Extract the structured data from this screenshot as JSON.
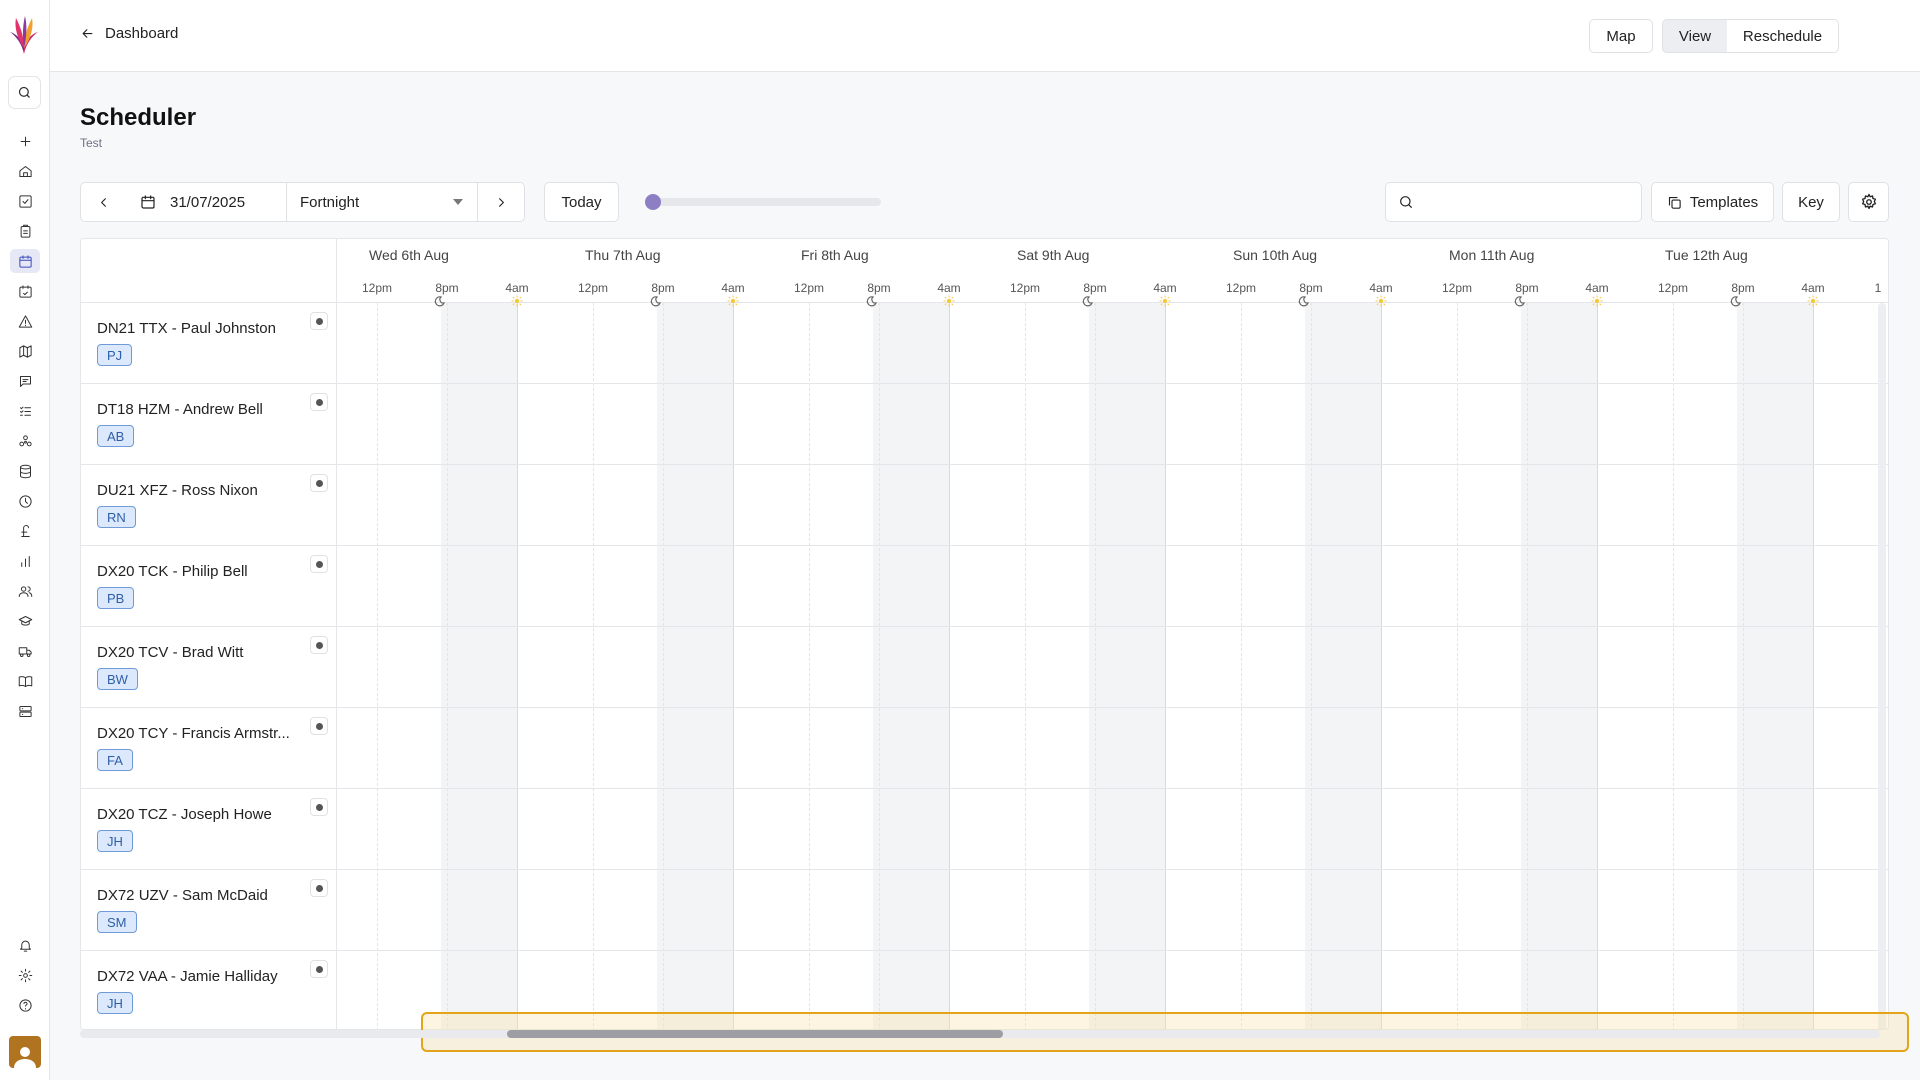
{
  "topbar": {
    "back_label": "Dashboard",
    "map_label": "Map",
    "view_label": "View",
    "reschedule_label": "Reschedule"
  },
  "page": {
    "title": "Scheduler",
    "subtitle": "Test"
  },
  "controls": {
    "date_value": "31/07/2025",
    "range_value": "Fortnight",
    "today_label": "Today",
    "zoom_level": 0.0,
    "search_placeholder": "",
    "templates_label": "Templates",
    "key_label": "Key"
  },
  "timeline": {
    "days": [
      "Wed 6th Aug",
      "Thu 7th Aug",
      "Fri 8th Aug",
      "Sat 9th Aug",
      "Sun 10th Aug",
      "Mon 11th Aug",
      "Tue 12th Aug"
    ],
    "times": [
      "12pm",
      "8pm",
      "4am"
    ],
    "trailing_time": "1"
  },
  "rows": [
    {
      "name": "DN21 TTX - Paul Johnston",
      "initials": "PJ"
    },
    {
      "name": "DT18 HZM - Andrew Bell",
      "initials": "AB"
    },
    {
      "name": "DU21 XFZ - Ross Nixon",
      "initials": "RN"
    },
    {
      "name": "DX20 TCK - Philip Bell",
      "initials": "PB"
    },
    {
      "name": "DX20 TCV - Brad Witt",
      "initials": "BW"
    },
    {
      "name": "DX20 TCY - Francis Armstr...",
      "initials": "FA"
    },
    {
      "name": "DX20 TCZ - Joseph Howe",
      "initials": "JH"
    },
    {
      "name": "DX72 UZV - Sam McDaid",
      "initials": "SM"
    },
    {
      "name": "DX72 VAA - Jamie Halliday",
      "initials": "JH"
    }
  ],
  "icons": {
    "rail": [
      "plus-icon",
      "home-icon",
      "tasks-icon",
      "clipboard-icon",
      "calendar-icon",
      "calendar-check-icon",
      "alert-icon",
      "map-icon",
      "chat-icon",
      "list-icon",
      "network-icon",
      "database-icon",
      "clock-icon",
      "pound-icon",
      "chart-icon",
      "users-icon",
      "graduation-icon",
      "truck-icon",
      "book-icon",
      "server-icon",
      "bell-icon",
      "gear-icon",
      "help-icon"
    ]
  },
  "colors": {
    "accent": "#3a4ab8",
    "badge_bg": "#dce8fb",
    "badge_border": "#6f9bd8",
    "highlight": "#e3a41a"
  }
}
